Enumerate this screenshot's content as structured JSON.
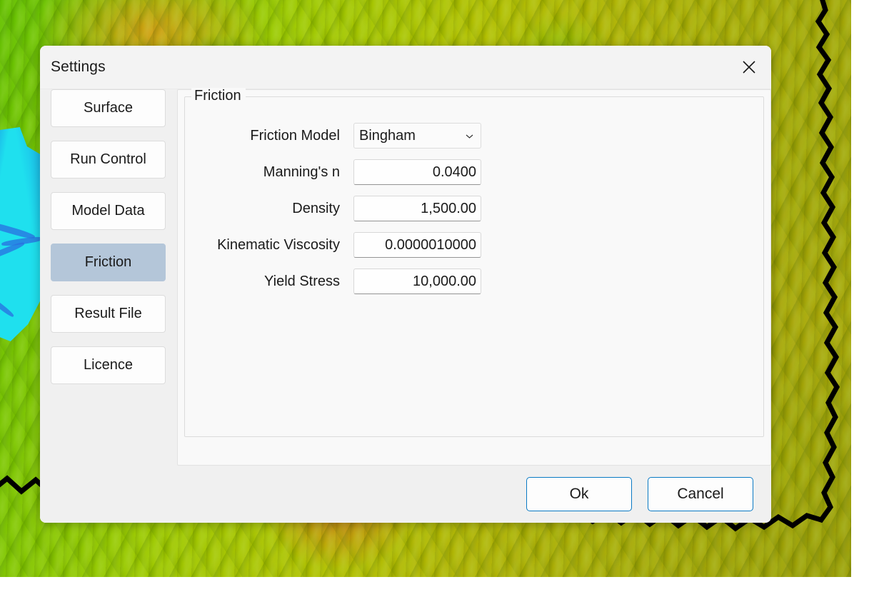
{
  "dialog": {
    "title": "Settings",
    "close_icon": "close-icon"
  },
  "sidebar": {
    "items": [
      {
        "label": "Surface",
        "selected": false
      },
      {
        "label": "Run Control",
        "selected": false
      },
      {
        "label": "Model Data",
        "selected": false
      },
      {
        "label": "Friction",
        "selected": true
      },
      {
        "label": "Result File",
        "selected": false
      },
      {
        "label": "Licence",
        "selected": false
      }
    ]
  },
  "content": {
    "group_title": "Friction",
    "fields": [
      {
        "label": "Friction Model",
        "type": "select",
        "value": "Bingham",
        "icon": "chevron-down-icon"
      },
      {
        "label": "Manning's n",
        "type": "text",
        "value": "0.0400"
      },
      {
        "label": "Density",
        "type": "text",
        "value": "1,500.00"
      },
      {
        "label": "Kinematic Viscosity",
        "type": "text",
        "value": "0.0000010000"
      },
      {
        "label": "Yield Stress",
        "type": "text",
        "value": "10,000.00"
      }
    ]
  },
  "footer": {
    "ok_label": "Ok",
    "cancel_label": "Cancel"
  },
  "colors": {
    "accent": "#0a7ac4",
    "selected_nav": "#b4c6d9",
    "dialog_background": "#f0f0f0",
    "title_bar": "#f3f3f3",
    "panel": "#f9f9f9",
    "water": "#1fe0ee",
    "terrain_low": "#63c000",
    "terrain_high": "#e09614"
  }
}
